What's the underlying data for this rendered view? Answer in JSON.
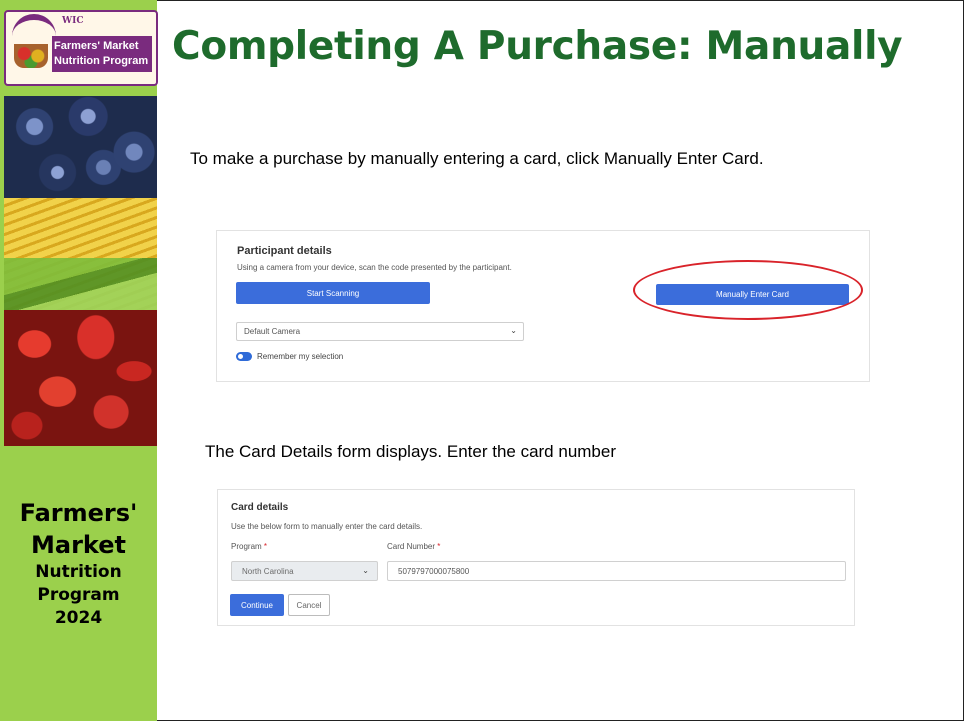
{
  "slide": {
    "title": "Completing A Purchase: Manually",
    "instruction_1": "To make a purchase by manually entering a card, click Manually Enter Card.",
    "instruction_2": "The Card Details form displays. Enter the card number"
  },
  "sidebar": {
    "logo": {
      "wic": "WIC",
      "line1": "Farmers' Market",
      "line2": "Nutrition Program"
    },
    "footer": {
      "line1": "Farmers'",
      "line2": "Market",
      "line3": "Nutrition",
      "line4": "Program",
      "line5": "2024"
    }
  },
  "participant_panel": {
    "heading": "Participant details",
    "description": "Using a camera from your device, scan the code presented by the participant.",
    "start_scanning_label": "Start Scanning",
    "manual_enter_label": "Manually Enter Card",
    "camera_select_value": "Default Camera",
    "remember_label": "Remember my selection",
    "remember_on": true
  },
  "card_panel": {
    "heading": "Card details",
    "description": "Use the below form to manually enter the card details.",
    "program_label": "Program",
    "program_value": "North Carolina",
    "card_number_label": "Card Number",
    "required_marker": "*",
    "card_number_value": "5079797000075800",
    "continue_label": "Continue",
    "cancel_label": "Cancel"
  },
  "colors": {
    "title_green": "#1e6b2c",
    "sidebar_green": "#9bd04c",
    "button_blue": "#3b6ddb",
    "highlight_red": "#d9232a"
  },
  "icons": {
    "select_chevron": "chevron-down-icon"
  }
}
